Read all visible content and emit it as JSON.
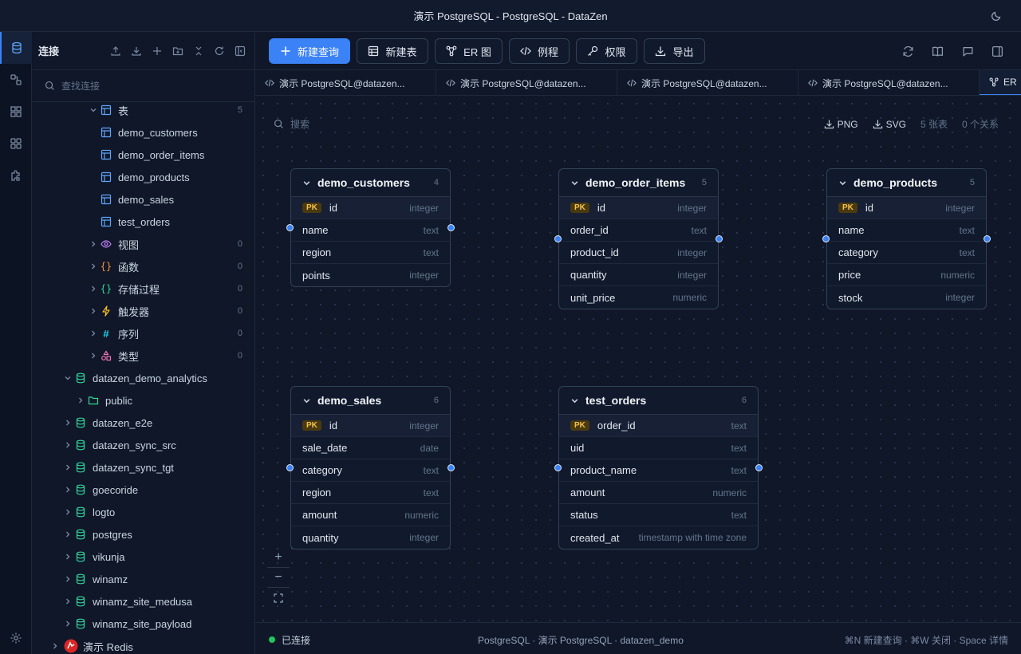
{
  "window": {
    "title": "演示 PostgreSQL - PostgreSQL - DataZen"
  },
  "sidebar": {
    "title": "连接",
    "search_placeholder": "查找连接",
    "tree": [
      {
        "label": "表",
        "count": "5"
      },
      {
        "label": "demo_customers"
      },
      {
        "label": "demo_order_items"
      },
      {
        "label": "demo_products"
      },
      {
        "label": "demo_sales"
      },
      {
        "label": "test_orders"
      },
      {
        "label": "视图",
        "count": "0"
      },
      {
        "label": "函数",
        "count": "0"
      },
      {
        "label": "存储过程",
        "count": "0"
      },
      {
        "label": "触发器",
        "count": "0"
      },
      {
        "label": "序列",
        "count": "0"
      },
      {
        "label": "类型",
        "count": "0"
      },
      {
        "label": "datazen_demo_analytics"
      },
      {
        "label": "public"
      },
      {
        "label": "datazen_e2e"
      },
      {
        "label": "datazen_sync_src"
      },
      {
        "label": "datazen_sync_tgt"
      },
      {
        "label": "goecoride"
      },
      {
        "label": "logto"
      },
      {
        "label": "postgres"
      },
      {
        "label": "vikunja"
      },
      {
        "label": "winamz"
      },
      {
        "label": "winamz_site_medusa"
      },
      {
        "label": "winamz_site_payload"
      },
      {
        "label": "演示 Redis"
      }
    ]
  },
  "toolbar": {
    "new_query": "新建查询",
    "new_table": "新建表",
    "er": "ER 图",
    "routine": "例程",
    "perm": "权限",
    "export": "导出"
  },
  "tabs": [
    {
      "label": "演示 PostgreSQL@datazen..."
    },
    {
      "label": "演示 PostgreSQL@datazen..."
    },
    {
      "label": "演示 PostgreSQL@datazen..."
    },
    {
      "label": "演示 PostgreSQL@datazen..."
    },
    {
      "label": "ER"
    }
  ],
  "canvas": {
    "search_placeholder": "搜索",
    "png": "PNG",
    "svg": "SVG",
    "table_count": "5 张表",
    "rel_count": "0 个关系"
  },
  "er_tables": [
    {
      "name": "demo_customers",
      "count": "4",
      "cols": [
        {
          "n": "id",
          "t": "integer",
          "pk": true
        },
        {
          "n": "name",
          "t": "text"
        },
        {
          "n": "region",
          "t": "text"
        },
        {
          "n": "points",
          "t": "integer"
        }
      ]
    },
    {
      "name": "demo_order_items",
      "count": "5",
      "cols": [
        {
          "n": "id",
          "t": "integer",
          "pk": true
        },
        {
          "n": "order_id",
          "t": "text"
        },
        {
          "n": "product_id",
          "t": "integer"
        },
        {
          "n": "quantity",
          "t": "integer"
        },
        {
          "n": "unit_price",
          "t": "numeric"
        }
      ]
    },
    {
      "name": "demo_products",
      "count": "5",
      "cols": [
        {
          "n": "id",
          "t": "integer",
          "pk": true
        },
        {
          "n": "name",
          "t": "text"
        },
        {
          "n": "category",
          "t": "text"
        },
        {
          "n": "price",
          "t": "numeric"
        },
        {
          "n": "stock",
          "t": "integer"
        }
      ]
    },
    {
      "name": "demo_sales",
      "count": "6",
      "cols": [
        {
          "n": "id",
          "t": "integer",
          "pk": true
        },
        {
          "n": "sale_date",
          "t": "date"
        },
        {
          "n": "category",
          "t": "text"
        },
        {
          "n": "region",
          "t": "text"
        },
        {
          "n": "amount",
          "t": "numeric"
        },
        {
          "n": "quantity",
          "t": "integer"
        }
      ]
    },
    {
      "name": "test_orders",
      "count": "6",
      "cols": [
        {
          "n": "order_id",
          "t": "text",
          "pk": true
        },
        {
          "n": "uid",
          "t": "text"
        },
        {
          "n": "product_name",
          "t": "text"
        },
        {
          "n": "amount",
          "t": "numeric"
        },
        {
          "n": "status",
          "t": "text"
        },
        {
          "n": "created_at",
          "t": "timestamp with time zone"
        }
      ]
    }
  ],
  "pk_label": "PK",
  "status": {
    "connected": "已连接",
    "info": "PostgreSQL · 演示 PostgreSQL · datazen_demo",
    "shortcuts": "⌘N 新建查询 · ⌘W 关闭 · Space 详情"
  }
}
